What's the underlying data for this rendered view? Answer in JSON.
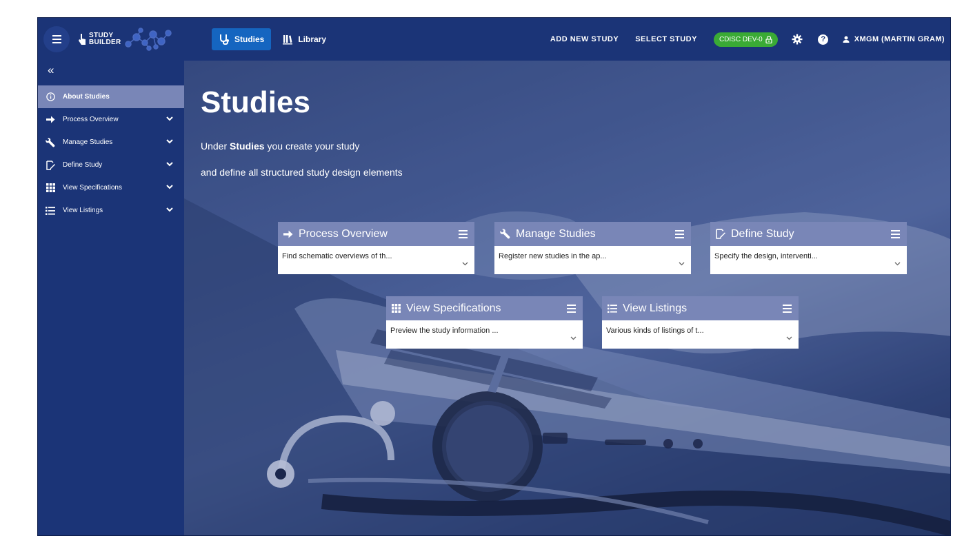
{
  "app": {
    "logo_text_top": "STUDY",
    "logo_text_bottom": "BUILDER"
  },
  "topnav": {
    "tabs": [
      {
        "label": "Studies",
        "icon": "stethoscope-icon",
        "active": true
      },
      {
        "label": "Library",
        "icon": "library-icon",
        "active": false
      }
    ],
    "add_new_study": "ADD NEW STUDY",
    "select_study": "SELECT STUDY",
    "environment": "CDISC DEV-0",
    "user": "XMGM (MARTIN GRAM)"
  },
  "sidebar": {
    "collapse_icon": "«",
    "items": [
      {
        "label": "About Studies",
        "icon": "info-icon",
        "active": true,
        "expandable": false
      },
      {
        "label": "Process Overview",
        "icon": "arrow-right-icon",
        "active": false,
        "expandable": true
      },
      {
        "label": "Manage Studies",
        "icon": "wrench-icon",
        "active": false,
        "expandable": true
      },
      {
        "label": "Define Study",
        "icon": "define-icon",
        "active": false,
        "expandable": true
      },
      {
        "label": "View Specifications",
        "icon": "grid-icon",
        "active": false,
        "expandable": true
      },
      {
        "label": "View Listings",
        "icon": "list-icon",
        "active": false,
        "expandable": true
      }
    ]
  },
  "main": {
    "title": "Studies",
    "intro_prefix": "Under ",
    "intro_bold": "Studies",
    "intro_suffix": " you create your study",
    "intro_line2": "and define all structured study design elements",
    "cards": [
      {
        "title": "Process Overview",
        "icon": "arrow-right-icon",
        "description": "Find schematic overviews of th..."
      },
      {
        "title": "Manage Studies",
        "icon": "wrench-icon",
        "description": "Register new studies in the ap..."
      },
      {
        "title": "Define Study",
        "icon": "define-icon",
        "description": "Specify the design, interventi..."
      },
      {
        "title": "View Specifications",
        "icon": "grid-icon",
        "description": "Preview the study information ..."
      },
      {
        "title": "View Listings",
        "icon": "list-icon",
        "description": "Various kinds of listings of t..."
      }
    ]
  },
  "colors": {
    "primary_dark": "#1b3477",
    "active_tab": "#1565c0",
    "accent_card": "#7986b7",
    "env_badge": "#3aaa35"
  }
}
